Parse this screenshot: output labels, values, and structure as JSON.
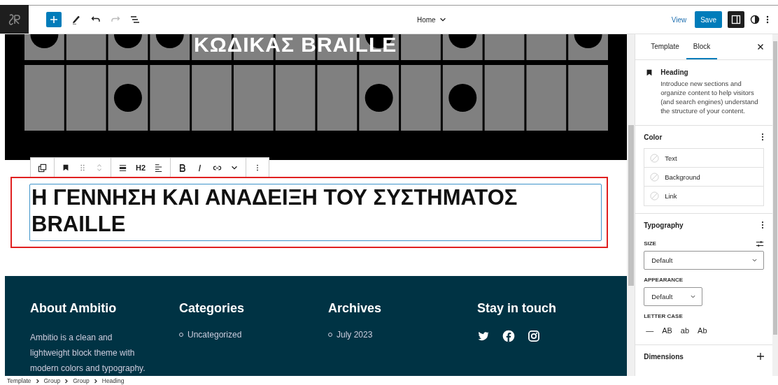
{
  "top_bar": {
    "document_title": "Home",
    "view_link": "View",
    "save_button": "Save"
  },
  "canvas": {
    "image_heading": "ΚΩΔΙΚΑΣ BRAILLE",
    "block_toolbar": {
      "heading_level": "H2"
    },
    "heading": "Η ΓΕΝΝΗΣΗ ΚΑΙ ΑΝΑΔΕΙΞΗ ΤΟΥ ΣΥΣΤΗΜΑΤΟΣ BRAILLE",
    "footer": {
      "columns": [
        {
          "kind": "text",
          "title": "About Ambitio",
          "text": "Ambitio is a clean and lightweight block theme with modern colors and typography."
        },
        {
          "kind": "list",
          "title": "Categories",
          "items": [
            "Uncategorized"
          ]
        },
        {
          "kind": "list",
          "title": "Archives",
          "items": [
            "July 2023"
          ]
        },
        {
          "kind": "social",
          "title": "Stay in touch"
        }
      ]
    }
  },
  "sidebar": {
    "tabs": [
      {
        "label": "Template",
        "selected": false
      },
      {
        "label": "Block",
        "selected": true
      }
    ],
    "block": {
      "name": "Heading",
      "description": "Introduce new sections and organize content to help visitors (and search engines) understand the structure of your content."
    },
    "color": {
      "title": "Color",
      "items": [
        "Text",
        "Background",
        "Link"
      ]
    },
    "typography": {
      "title": "Typography",
      "size_label": "SIZE",
      "size_value": "Default",
      "appearance_label": "APPEARANCE",
      "appearance_value": "Default",
      "letter_case_label": "LETTER CASE",
      "letter_case_options": [
        "—",
        "AB",
        "ab",
        "Ab"
      ]
    },
    "dimensions": {
      "title": "Dimensions"
    }
  },
  "breadcrumbs": [
    "Template",
    "Group",
    "Group",
    "Heading"
  ]
}
